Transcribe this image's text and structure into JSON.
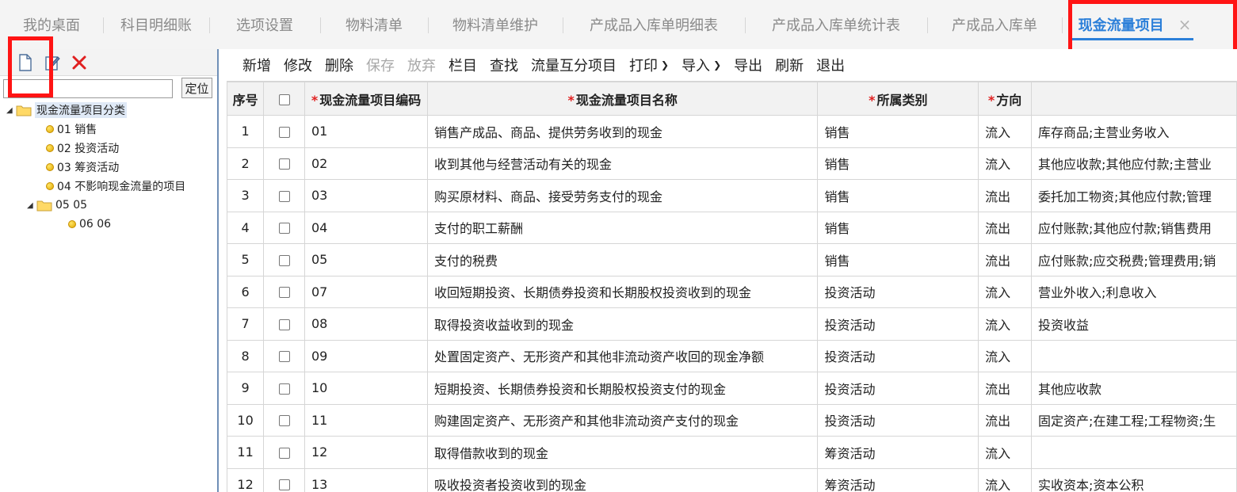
{
  "tabs": [
    {
      "label": "我的桌面"
    },
    {
      "label": "科目明细账"
    },
    {
      "label": "选项设置"
    },
    {
      "label": "物料清单"
    },
    {
      "label": "物料清单维护"
    },
    {
      "label": "产成品入库单明细表"
    },
    {
      "label": "产成品入库单统计表"
    },
    {
      "label": "产成品入库单"
    },
    {
      "label": "现金流量项目",
      "close": "×"
    }
  ],
  "sidebar": {
    "locate_label": "定位",
    "search_value": "",
    "tree": {
      "root": "现金流量项目分类",
      "items": [
        "01 销售",
        "02 投资活动",
        "03 筹资活动",
        "04 不影响现金流量的项目",
        "05 05",
        "06 06"
      ]
    }
  },
  "toolbar": {
    "items": [
      "新增",
      "修改",
      "删除",
      "保存",
      "放弃",
      "栏目",
      "查找",
      "流量互分项目",
      "打印",
      "导入",
      "导出",
      "刷新",
      "退出"
    ]
  },
  "table": {
    "headers": {
      "seq": "序号",
      "code": "现金流量项目编码",
      "name": "现金流量项目名称",
      "category": "所属类别",
      "direction": "方向",
      "subjects": ""
    },
    "rows": [
      {
        "seq": "1",
        "code": "01",
        "name": "销售产成品、商品、提供劳务收到的现金",
        "category": "销售",
        "direction": "流入",
        "subjects": "库存商品;主营业务收入"
      },
      {
        "seq": "2",
        "code": "02",
        "name": "收到其他与经营活动有关的现金",
        "category": "销售",
        "direction": "流入",
        "subjects": "其他应收款;其他应付款;主营业"
      },
      {
        "seq": "3",
        "code": "03",
        "name": "购买原材料、商品、接受劳务支付的现金",
        "category": "销售",
        "direction": "流出",
        "subjects": "委托加工物资;其他应付款;管理"
      },
      {
        "seq": "4",
        "code": "04",
        "name": "支付的职工薪酬",
        "category": "销售",
        "direction": "流出",
        "subjects": "应付账款;其他应付款;销售费用"
      },
      {
        "seq": "5",
        "code": "05",
        "name": "支付的税费",
        "category": "销售",
        "direction": "流出",
        "subjects": "应付账款;应交税费;管理费用;销"
      },
      {
        "seq": "6",
        "code": "07",
        "name": "收回短期投资、长期债券投资和长期股权投资收到的现金",
        "category": "投资活动",
        "direction": "流入",
        "subjects": "营业外收入;利息收入"
      },
      {
        "seq": "7",
        "code": "08",
        "name": "取得投资收益收到的现金",
        "category": "投资活动",
        "direction": "流入",
        "subjects": "投资收益"
      },
      {
        "seq": "8",
        "code": "09",
        "name": "处置固定资产、无形资产和其他非流动资产收回的现金净额",
        "category": "投资活动",
        "direction": "流入",
        "subjects": ""
      },
      {
        "seq": "9",
        "code": "10",
        "name": "短期投资、长期债券投资和长期股权投资支付的现金",
        "category": "投资活动",
        "direction": "流出",
        "subjects": "其他应收款"
      },
      {
        "seq": "10",
        "code": "11",
        "name": "购建固定资产、无形资产和其他非流动资产支付的现金",
        "category": "投资活动",
        "direction": "流出",
        "subjects": "固定资产;在建工程;工程物资;生"
      },
      {
        "seq": "11",
        "code": "12",
        "name": "取得借款收到的现金",
        "category": "筹资活动",
        "direction": "流入",
        "subjects": ""
      },
      {
        "seq": "12",
        "code": "13",
        "name": "吸收投资者投资收到的现金",
        "category": "筹资活动",
        "direction": "流入",
        "subjects": "实收资本;资本公积"
      }
    ]
  },
  "colors": {
    "accent": "#2b7fd9",
    "highlight": "#ff1414"
  }
}
